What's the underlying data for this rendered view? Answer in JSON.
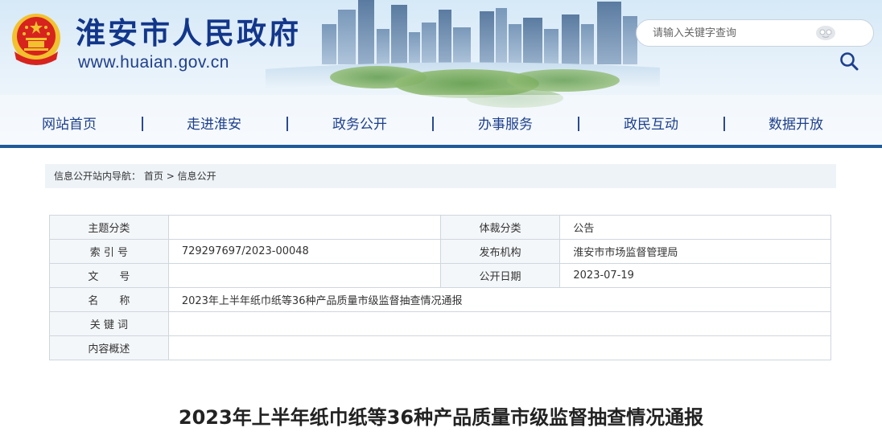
{
  "header": {
    "site_title": "淮安市人民政府",
    "site_url": "www.huaian.gov.cn",
    "search_placeholder": "请输入关键字查询",
    "colors": {
      "title": "#12368a",
      "nav_text": "#1d3f8c",
      "nav_bar": "#1e5a9a",
      "emblem_red": "#d7231e",
      "emblem_gold": "#f2c12e"
    }
  },
  "nav": {
    "items": [
      {
        "label": "网站首页"
      },
      {
        "label": "走进淮安"
      },
      {
        "label": "政务公开"
      },
      {
        "label": "办事服务"
      },
      {
        "label": "政民互动"
      },
      {
        "label": "数据开放"
      }
    ],
    "separator": "|"
  },
  "breadcrumb": {
    "prefix": "信息公开站内导航：",
    "home": "首页",
    "arrow": ">",
    "current": "信息公开"
  },
  "info_table": {
    "rows": [
      {
        "label1": "主题分类",
        "value1": "",
        "label2": "体裁分类",
        "value2": "公告"
      },
      {
        "label1": "索 引 号",
        "value1": "729297697/2023-00048",
        "label2": "发布机构",
        "value2": "淮安市市场监督管理局"
      },
      {
        "label1": "文　　号",
        "value1": "",
        "label2": "公开日期",
        "value2": "2023-07-19"
      },
      {
        "label1": "名　　称",
        "value1": "2023年上半年纸巾纸等36种产品质量市级监督抽查情况通报"
      },
      {
        "label1": "关 键 词",
        "value1": ""
      },
      {
        "label1": "内容概述",
        "value1": ""
      }
    ]
  },
  "article": {
    "title": "2023年上半年纸巾纸等36种产品质量市级监督抽查情况通报"
  },
  "icons": {
    "emblem": "national-emblem-icon",
    "search": "search-icon",
    "accessibility": "accessibility-icon"
  }
}
